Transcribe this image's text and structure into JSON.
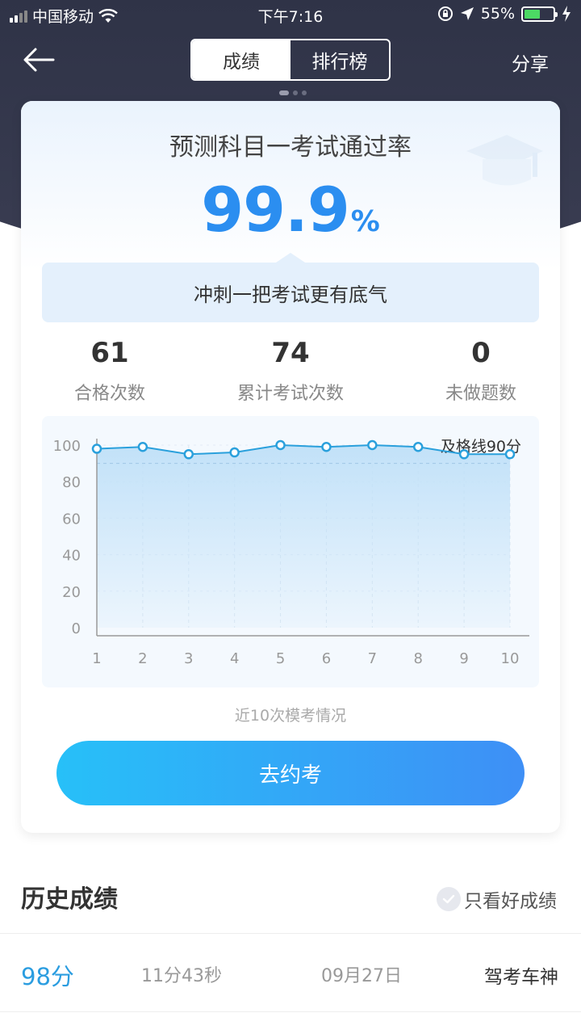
{
  "status_bar": {
    "carrier": "中国移动",
    "time": "下午7:16",
    "battery_pct": "55%",
    "battery_level": 0.55
  },
  "nav": {
    "tabs": [
      {
        "label": "成绩",
        "active": true
      },
      {
        "label": "排行榜",
        "active": false
      }
    ],
    "share_label": "分享"
  },
  "card": {
    "title": "预测科目一考试通过率",
    "rate_value": "99.9",
    "rate_unit": "%",
    "banner_text": "冲刺一把考试更有底气",
    "stats": [
      {
        "value": "61",
        "label": "合格次数"
      },
      {
        "value": "74",
        "label": "累计考试次数"
      },
      {
        "value": "0",
        "label": "未做题数"
      }
    ],
    "chart_caption": "近10次模考情况",
    "button_label": "去约考"
  },
  "chart_data": {
    "type": "area",
    "x": [
      1,
      2,
      3,
      4,
      5,
      6,
      7,
      8,
      9,
      10
    ],
    "values": [
      98,
      99,
      95,
      96,
      100,
      99,
      100,
      99,
      95,
      95
    ],
    "yticks": [
      0,
      20,
      40,
      60,
      80,
      100
    ],
    "ylim": [
      0,
      100
    ],
    "reference_line": {
      "value": 90,
      "label": "及格线90分"
    },
    "colors": {
      "line": "#2aa0dc",
      "fill": "#bfe0f8",
      "point": "#2aa0dc"
    }
  },
  "history": {
    "title": "历史成绩",
    "filter_label": "只看好成绩",
    "rows": [
      {
        "score": "98分",
        "duration": "11分43秒",
        "date": "09月27日",
        "title": "驾考车神"
      }
    ]
  },
  "colors": {
    "accent": "#2b8ef0",
    "header_bg": "#2f3347",
    "button_start": "#27c0f8",
    "button_end": "#3e8ff6"
  }
}
